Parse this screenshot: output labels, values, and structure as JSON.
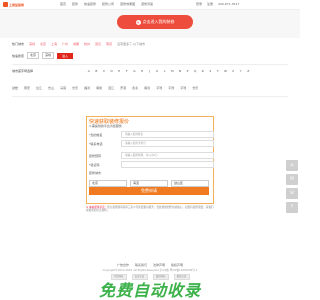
{
  "header": {
    "brand": "土拨鼠装修",
    "nav": [
      "首页",
      "装修",
      "快速装修",
      "装修公司",
      "装修效果图",
      "装修问答"
    ],
    "login": "登录",
    "register": "注册",
    "phone": "400-871-3527"
  },
  "hero": {
    "cta_label": "点击进入我的装修"
  },
  "city": {
    "label": "热门城市",
    "hot": [
      "深圳",
      "北京",
      "上海",
      "广州",
      "成都",
      "杭州",
      "武汉",
      "南京"
    ],
    "more": "没有更多了,以下城市"
  },
  "quick": {
    "label": "快速搜索",
    "province": "北京",
    "city": "深圳",
    "enter": "进入"
  },
  "letters": {
    "label": "城市首字母选择",
    "items": [
      "A",
      "B",
      "C",
      "D",
      "E",
      "F",
      "G",
      "H",
      "J",
      "K",
      "L",
      "M",
      "N",
      "P",
      "Q",
      "R",
      "S",
      "T",
      "W",
      "X",
      "Y",
      "Z"
    ]
  },
  "districts": [
    "鼓楼",
    "晋安",
    "台江",
    "仓山",
    "马尾",
    "长乐",
    "福清",
    "闽侯",
    "连江",
    "罗源",
    "永泰",
    "闽清",
    "平潭",
    "平潭",
    "平潭",
    "长乐"
  ],
  "form": {
    "title": "快速获取装修报价",
    "subtitle": "3.需提供的平台为您服务",
    "fields": [
      {
        "label": "*您的姓名",
        "placeholder": "请输入您的姓名"
      },
      {
        "label": "*联系电话",
        "placeholder": "请输入您的手机号"
      },
      {
        "label": "装修预算",
        "placeholder": "请输入装修预算，可以为5万"
      },
      {
        "label": "*验证码",
        "placeholder": ""
      },
      {
        "label": "装修城市",
        "placeholder": ""
      }
    ],
    "selects": [
      "北京",
      "海淀",
      "鼓山区"
    ],
    "submit": "免费申请",
    "note_label": "※ 本站郑重承诺：",
    "note_text": "您为装修期间获得三家公司免费报价服务，仅装修规划所用请放心，如您有装修需要，请我们保留您的信息资料。"
  },
  "sidebar": [
    "⌂",
    "✉",
    "☏",
    "⇡"
  ],
  "footer": {
    "links": [
      "广告合作",
      "联系我们",
      "法律声明",
      "版权声明"
    ],
    "copyright": "Copyright©2013-2018 .All Rights Reserved 京ICP备 粤ICP备12050006号-1",
    "badges": [
      "可信网站",
      "安全认证",
      "诚信网站",
      "备案认证"
    ]
  },
  "watermark": "免费自动收录"
}
